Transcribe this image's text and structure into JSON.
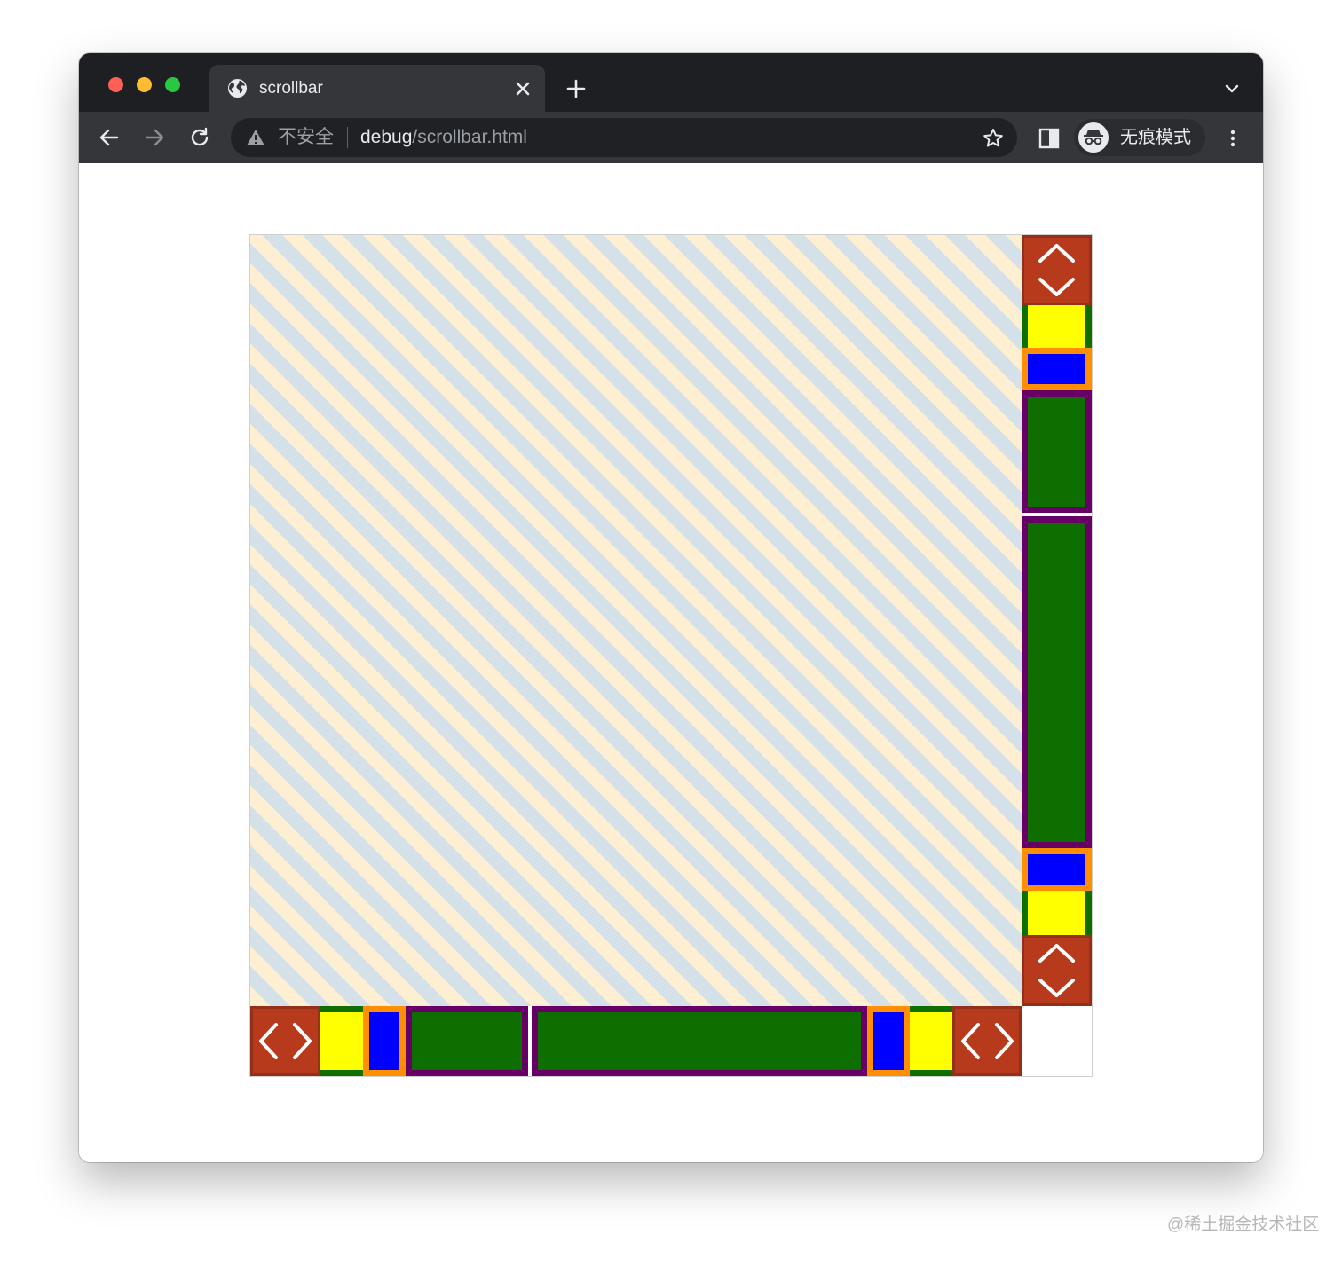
{
  "browser": {
    "tab": {
      "title": "scrollbar",
      "icon": "globe-icon"
    },
    "address": {
      "security_label": "不安全",
      "url_host": "debug",
      "url_path": "/scrollbar.html"
    },
    "profile": {
      "label": "无痕模式",
      "icon": "incognito-icon"
    }
  },
  "scrollbar_colors": {
    "button": "#b83a1c",
    "track": "#ffff00",
    "track_border": "#0e6e00",
    "track_piece": "#0000ff",
    "track_piece_border": "#ff8f00",
    "thumb": "#0e6e00",
    "thumb_border": "#660066",
    "content_stripe_a": "#ffefd2",
    "content_stripe_b": "#d5e1e9"
  },
  "watermark": "@稀土掘金技术社区"
}
